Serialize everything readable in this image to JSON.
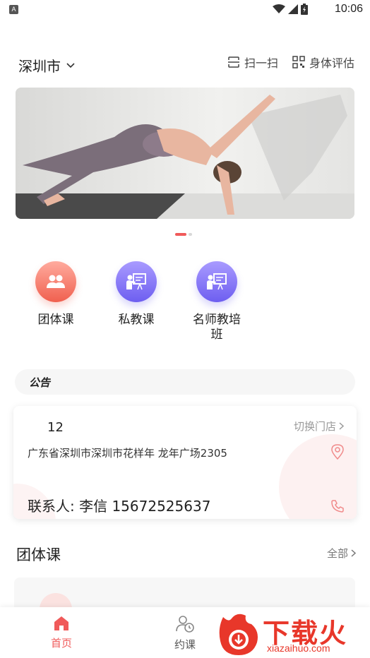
{
  "status_bar": {
    "time": "10:06",
    "notification_badge": "A"
  },
  "header": {
    "city": "深圳市",
    "scan_label": "扫一扫",
    "assessment_label": "身体评估"
  },
  "banner": {
    "page_count": 2,
    "active_index": 0
  },
  "categories": [
    {
      "label": "团体课",
      "icon": "group-icon",
      "color": "#f0604f"
    },
    {
      "label": "私教课",
      "icon": "trainer-board-icon",
      "color": "#6d5ef0"
    },
    {
      "label": "名师教培班",
      "icon": "trainer-board-icon",
      "color": "#6d5ef0"
    }
  ],
  "notice": {
    "tag": "公告"
  },
  "store": {
    "name": "12",
    "switch_label": "切换门店",
    "address": "广东省深圳市深圳市花样年 龙年广场2305",
    "contact": "联系人: 李信   15672525637"
  },
  "group_section": {
    "title": "团体课",
    "all_label": "全部"
  },
  "tabbar": [
    {
      "label": "首页",
      "icon": "home-icon",
      "active": true
    },
    {
      "label": "约课",
      "icon": "booking-icon",
      "active": false
    }
  ],
  "watermark": {
    "text": "下载火",
    "url": "xiazaihuo.com"
  },
  "colors": {
    "accent": "#f05a5a",
    "purple": "#6d5ef0",
    "watermark": "#e8372a"
  }
}
